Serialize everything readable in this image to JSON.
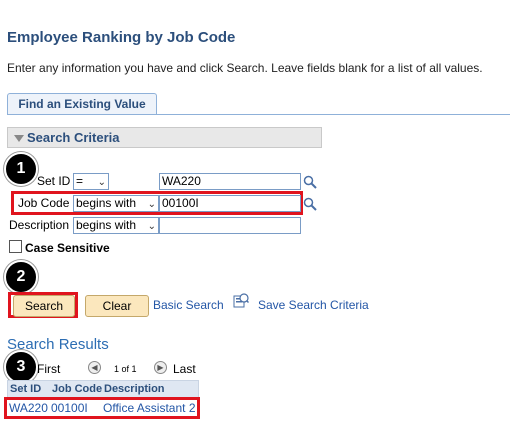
{
  "page": {
    "title": "Employee Ranking by Job Code",
    "instructions": "Enter any information you have and click Search. Leave fields blank for a list of all values."
  },
  "tabs": [
    {
      "label": "Find an Existing Value"
    }
  ],
  "search_criteria": {
    "header": "Search Criteria",
    "fields": [
      {
        "label": "Set ID",
        "operator": "=",
        "value": "WA220"
      },
      {
        "label": "Job Code",
        "operator": "begins with",
        "value": "00100I"
      },
      {
        "label": "Description",
        "operator": "begins with",
        "value": ""
      }
    ],
    "case_sensitive_label": "Case Sensitive"
  },
  "callouts": [
    "1",
    "2",
    "3"
  ],
  "actions": {
    "search": "Search",
    "clear": "Clear",
    "basic_search": "Basic Search",
    "save_criteria": "Save Search Criteria"
  },
  "results": {
    "title": "Search Results",
    "nav": {
      "first": "First",
      "page_info": "1 of 1",
      "last": "Last"
    },
    "columns": [
      "Set ID",
      "Job Code",
      "Description"
    ],
    "rows": [
      {
        "set_id": "WA220",
        "job_code": "00100I",
        "description": "Office Assistant 2"
      }
    ]
  },
  "colors": {
    "highlight": "#e0141e",
    "link": "#2356a6",
    "title": "#2c4f7c"
  },
  "icons": [
    "lookup-icon",
    "save-criteria-icon",
    "collapse-triangle-icon",
    "prev-icon",
    "next-icon"
  ]
}
